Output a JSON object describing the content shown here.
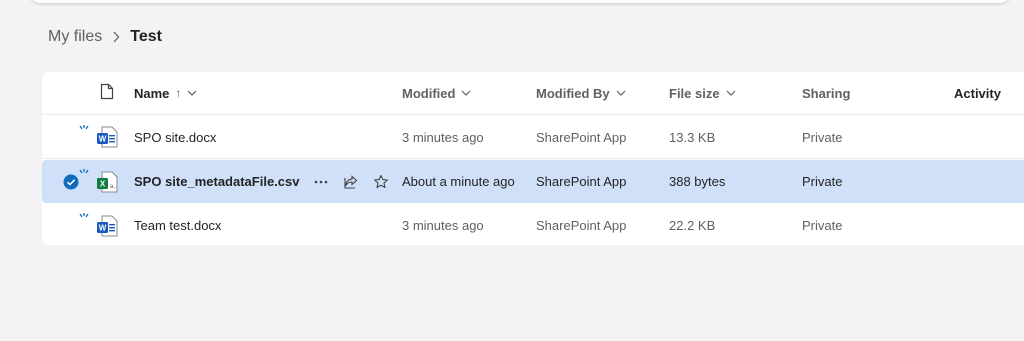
{
  "breadcrumb": {
    "parent": "My files",
    "current": "Test"
  },
  "columns": {
    "name": "Name",
    "sort_indicator": "↑",
    "modified": "Modified",
    "modified_by": "Modified By",
    "file_size": "File size",
    "sharing": "Sharing",
    "activity": "Activity"
  },
  "files": [
    {
      "name": "SPO site.docx",
      "type": "word-doc-icon",
      "modified": "3 minutes ago",
      "modified_by": "SharePoint App",
      "size": "13.3 KB",
      "sharing": "Private",
      "selected": false
    },
    {
      "name": "SPO site_metadataFile.csv",
      "type": "excel-csv-icon",
      "modified": "About a minute ago",
      "modified_by": "SharePoint App",
      "size": "388 bytes",
      "sharing": "Private",
      "selected": true
    },
    {
      "name": "Team test.docx",
      "type": "word-doc-icon",
      "modified": "3 minutes ago",
      "modified_by": "SharePoint App",
      "size": "22.2 KB",
      "sharing": "Private",
      "selected": false
    }
  ],
  "colors": {
    "selection": "#cfe0f8",
    "accent": "#0f6cbd",
    "word": "#185abd",
    "excel": "#107c41"
  }
}
